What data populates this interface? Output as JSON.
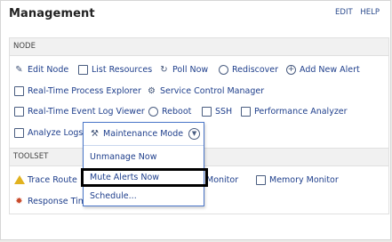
{
  "header": {
    "title": "Management",
    "edit_label": "EDIT",
    "help_label": "HELP"
  },
  "sections": {
    "node": "NODE",
    "toolset": "TOOLSET"
  },
  "node_actions": {
    "edit_node": "Edit Node",
    "list_resources": "List Resources",
    "poll_now": "Poll Now",
    "rediscover": "Rediscover",
    "add_new_alert": "Add New Alert",
    "realtime_process_explorer": "Real-Time Process Explorer",
    "service_control_manager": "Service Control Manager",
    "realtime_event_log_viewer": "Real-Time Event Log Viewer",
    "reboot": "Reboot",
    "ssh": "SSH",
    "performance_analyzer": "Performance Analyzer",
    "analyze_logs": "Analyze Logs"
  },
  "toolset_actions": {
    "trace_route": "Trace Route",
    "monitor_partial": "Monitor",
    "memory_monitor": "Memory Monitor",
    "response_time_partial": "Response Tim"
  },
  "maintenance": {
    "label": "Maintenance Mode",
    "options": [
      "Unmanage Now",
      "Mute Alerts Now",
      "Schedule..."
    ]
  }
}
